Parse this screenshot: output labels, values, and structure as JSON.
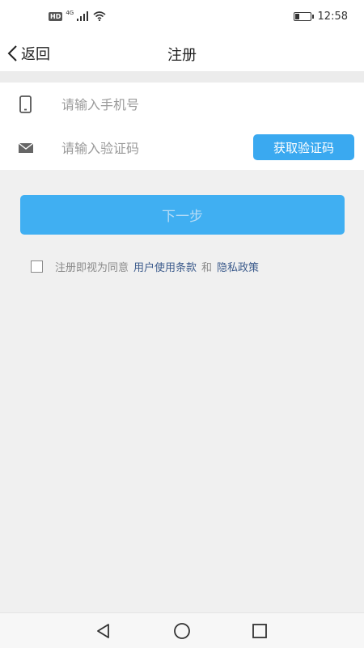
{
  "status_bar": {
    "hd_label": "HD",
    "network_label": "4G",
    "time": "12:58",
    "battery_level": 0.3
  },
  "header": {
    "back_label": "返回",
    "title": "注册"
  },
  "form": {
    "phone_placeholder": "请输入手机号",
    "phone_icon": "phone-icon",
    "code_placeholder": "请输入验证码",
    "code_icon": "envelope-icon",
    "get_code_label": "获取验证码"
  },
  "next_button_label": "下一步",
  "agreement": {
    "checked": false,
    "prefix": "注册即视为同意",
    "terms_link": "用户使用条款",
    "and": "和",
    "privacy_link": "隐私政策"
  },
  "nav_bar": {
    "back_icon": "triangle-back-icon",
    "home_icon": "circle-home-icon",
    "recent_icon": "square-recent-icon"
  },
  "colors": {
    "accent": "#3aa9f0",
    "link": "#3c5b8c",
    "background": "#f0f0f0"
  }
}
